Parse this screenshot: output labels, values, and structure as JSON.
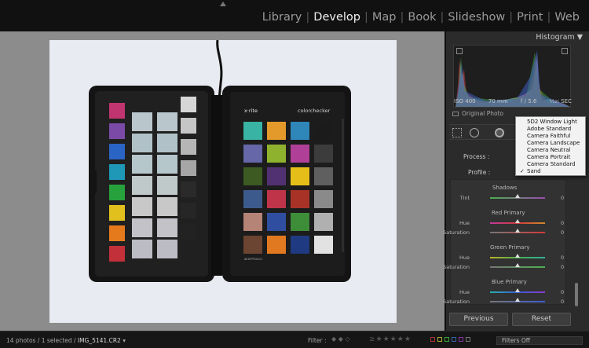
{
  "modules": [
    {
      "label": "Library",
      "active": false
    },
    {
      "label": "Develop",
      "active": true
    },
    {
      "label": "Map",
      "active": false
    },
    {
      "label": "Book",
      "active": false
    },
    {
      "label": "Slideshow",
      "active": false
    },
    {
      "label": "Print",
      "active": false
    },
    {
      "label": "Web",
      "active": false
    }
  ],
  "histogram": {
    "title": "Histogram",
    "iso": "ISO 400",
    "focal": "70 mm",
    "aperture": "f / 5.6",
    "shutter": "¹⁄₁₂₅ SEC",
    "original_photo": "Original Photo"
  },
  "camera_calibration": {
    "process_label": "Process :",
    "process_value": "20",
    "profile_label": "Profile :",
    "profile_dropdown": {
      "options": [
        "5D2 Window Light",
        "Adobe Standard",
        "Camera Faithful",
        "Camera Landscape",
        "Camera Neutral",
        "Camera Portrait",
        "Camera Standard",
        "Sand"
      ],
      "selected": "Sand"
    },
    "shadows": {
      "title": "Shadows",
      "tint": {
        "label": "Tint",
        "value": "0"
      }
    },
    "red": {
      "title": "Red Primary",
      "hue": {
        "label": "Hue",
        "value": "0"
      },
      "saturation": {
        "label": "Saturation",
        "value": "0"
      }
    },
    "green": {
      "title": "Green Primary",
      "hue": {
        "label": "Hue",
        "value": "0"
      },
      "saturation": {
        "label": "Saturation",
        "value": "0"
      }
    },
    "blue": {
      "title": "Blue Primary",
      "hue": {
        "label": "Hue",
        "value": "0"
      },
      "saturation": {
        "label": "Saturation",
        "value": "0"
      }
    }
  },
  "buttons": {
    "previous": "Previous",
    "reset": "Reset"
  },
  "photo": {
    "brand_left": "x·rite",
    "brand_right": "colorchecker",
    "serial": "#0IEPPGG4I1"
  },
  "statusbar": {
    "count": "14 photos / 1 selected / ",
    "file": "IMG_5141.CR2",
    "filter_label": "Filter :",
    "filters_off": "Filters Off"
  },
  "colors": {
    "accent_active": "#f0f0f0",
    "panel_bg": "#2b2b2b",
    "checker_patches": [
      "#39b3a3",
      "#e39a2a",
      "#2f86b8",
      "#1b1b1b",
      "#6567a8",
      "#8fb22e",
      "#b03f98",
      "#3c3c3c",
      "#3d5a22",
      "#523172",
      "#e6be1a",
      "#5f5f5f",
      "#3c5b8c",
      "#bf3448",
      "#a83226",
      "#8a8a8a",
      "#b58476",
      "#2f4ea0",
      "#3d8d39",
      "#b0b0b0",
      "#6b4432",
      "#e07920",
      "#1f3a80",
      "#e2e2e2"
    ],
    "left_strip_patches": [
      "#c0356f",
      "#7b4aa6",
      "#2a64c4",
      "#1f98b8",
      "#27a13c",
      "#e1c01e",
      "#e57a1d",
      "#c2303a"
    ]
  }
}
